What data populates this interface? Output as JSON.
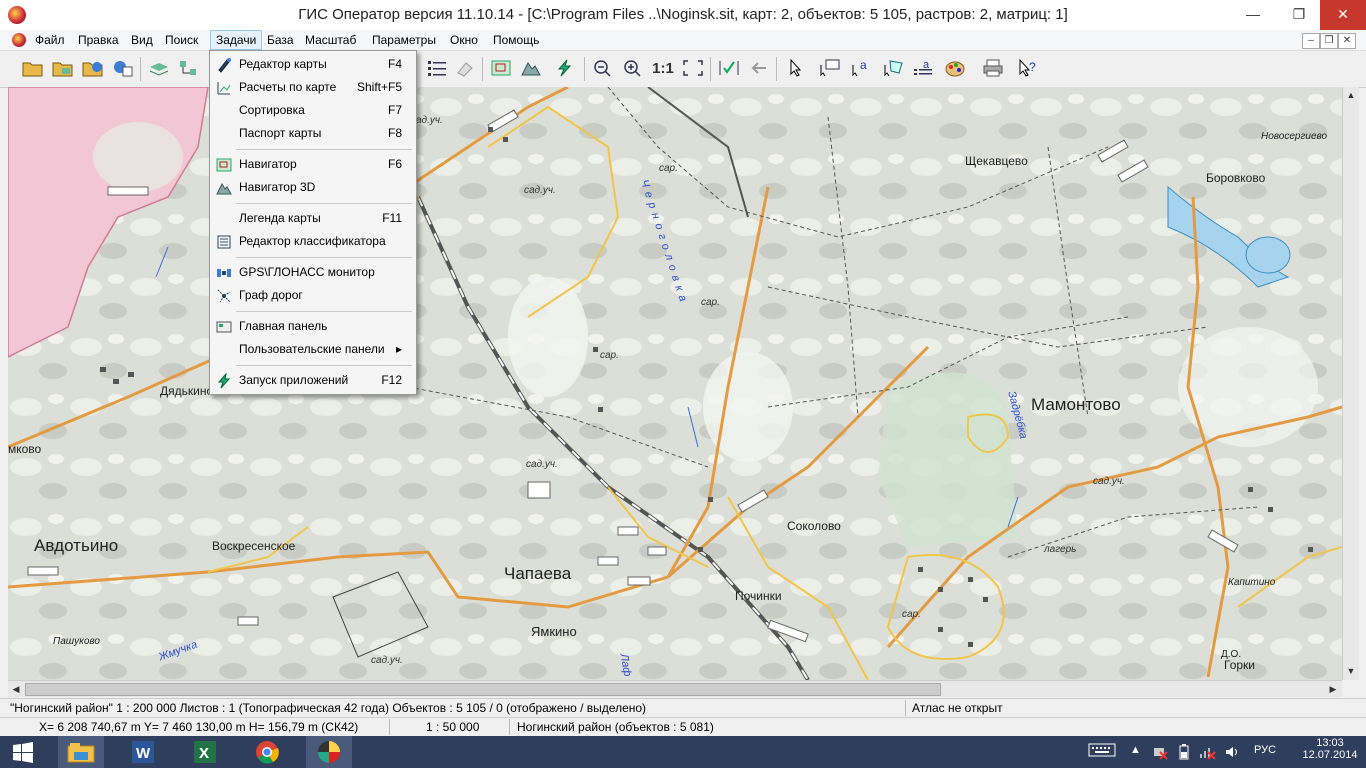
{
  "window": {
    "title": "ГИС Оператор версия 11.10.14 - [C:\\Program Files ..\\Noginsk.sit, карт: 2, объектов: 5 105, растров: 2, матриц: 1]",
    "controls": {
      "minimize": "—",
      "restore": "❐",
      "close": "✕"
    }
  },
  "menubar": {
    "items": [
      "Файл",
      "Правка",
      "Вид",
      "Поиск",
      "Задачи",
      "База",
      "Масштаб",
      "Параметры",
      "Окно",
      "Помощь"
    ],
    "active": "Задачи",
    "mdi_controls": {
      "minimize": "–",
      "restore": "❐",
      "close": "✕"
    }
  },
  "toolbar": {
    "scale_label": "1:1"
  },
  "tasks_menu": {
    "items": [
      {
        "label": "Редактор карты",
        "key": "F4",
        "icon": "pen-icon"
      },
      {
        "label": "Расчеты по карте",
        "key": "Shift+F5",
        "icon": "ruler-icon"
      },
      {
        "label": "Сортировка",
        "key": "F7",
        "icon": ""
      },
      {
        "label": "Паспорт карты",
        "key": "F8",
        "icon": ""
      },
      {
        "label": "Навигатор",
        "key": "F6",
        "icon": "navigator-icon"
      },
      {
        "label": "Навигатор 3D",
        "key": "",
        "icon": "navigator-3d-icon"
      },
      {
        "label": "Легенда карты",
        "key": "F11",
        "icon": ""
      },
      {
        "label": "Редактор классификатора",
        "key": "",
        "icon": "classifier-icon"
      },
      {
        "label": "GPS\\ГЛОНАСС монитор",
        "key": "",
        "icon": "satellite-icon"
      },
      {
        "label": "Граф дорог",
        "key": "",
        "icon": "road-graph-icon"
      },
      {
        "label": "Главная панель",
        "key": "",
        "icon": "panel-icon"
      },
      {
        "label": "Пользовательские панели",
        "key": "▸",
        "icon": ""
      },
      {
        "label": "Запуск приложений",
        "key": "F12",
        "icon": "launch-icon"
      }
    ]
  },
  "map": {
    "places": {
      "dyadkino": "Дядькино",
      "mkovo": "мково",
      "avdotyino": "Авдотьино",
      "voskresenskoe": "Воскресенское",
      "pashukovo": "Пашуково",
      "chapaeva": "Чапаева",
      "yamkino": "Ямкино",
      "pochinki": "Починки",
      "sokolovo": "Соколово",
      "shchekavtsevo": "Щекавцево",
      "mamontovo": "Мамонтово",
      "borovkovo": "Боровково",
      "novosergievo": "Новосергиево",
      "kapitino": "Капитино",
      "gorki": "Горки",
      "do": "Д.О."
    },
    "small_labels": {
      "sad1": "сад.уч.",
      "sad2": "сад.уч.",
      "sad3": "сад.уч.",
      "sad4": "сад.уч.",
      "sad5": "сад.уч.",
      "sar1": "сар.",
      "sar2": "сар.",
      "sar3": "сар.",
      "sar4": "сар.",
      "lager": "лагерь"
    },
    "rivers": {
      "chernogolovka": "Черноголовка",
      "zadrebka": "Задрёбка",
      "zhmuchka": "Жмучка",
      "lak": "Лаф"
    }
  },
  "status_bar": {
    "line1": {
      "map_info": "\"Ногинский район\"  1 : 200 000   Листов : 1   (Топографическая 42 года)  Объектов : 5 105 / 0  (отображено / выделено)",
      "atlas": "Атлас не открыт"
    },
    "line2": {
      "coords": "X= 6 208 740,67 m  Y= 7 460 130,00 m  H=  156,79 m  (СК42)",
      "scale": "1 : 50 000",
      "layer": "Ногинский район   (объектов : 5 081)"
    }
  },
  "taskbar": {
    "lang": "РУС",
    "time": "13:03",
    "date": "12.07.2014",
    "apps": [
      "windows-start",
      "file-explorer",
      "word",
      "excel",
      "chrome",
      "gis-operator"
    ]
  }
}
